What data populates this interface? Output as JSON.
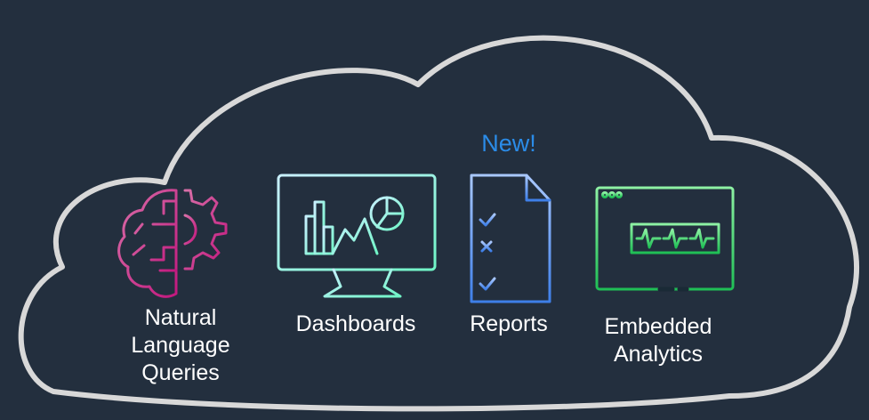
{
  "badge": {
    "text": "New!",
    "color": "#2b8ce8"
  },
  "features": [
    {
      "label_lines": [
        "Natural",
        "Language",
        "Queries"
      ],
      "icon": "brain-gear-icon",
      "color": "#c72f8f"
    },
    {
      "label_lines": [
        "Dashboards"
      ],
      "icon": "dashboard-monitor-icon",
      "color": "#8ff2d8"
    },
    {
      "label_lines": [
        "Reports"
      ],
      "icon": "report-checklist-icon",
      "color": "#4f8ff0"
    },
    {
      "label_lines": [
        "Embedded",
        "Analytics"
      ],
      "icon": "embedded-analytics-window-icon",
      "color": "#3ed67a"
    }
  ],
  "colors": {
    "background": "#232f3e",
    "cloud_outline": "#d8d8d8",
    "text": "#ffffff"
  }
}
